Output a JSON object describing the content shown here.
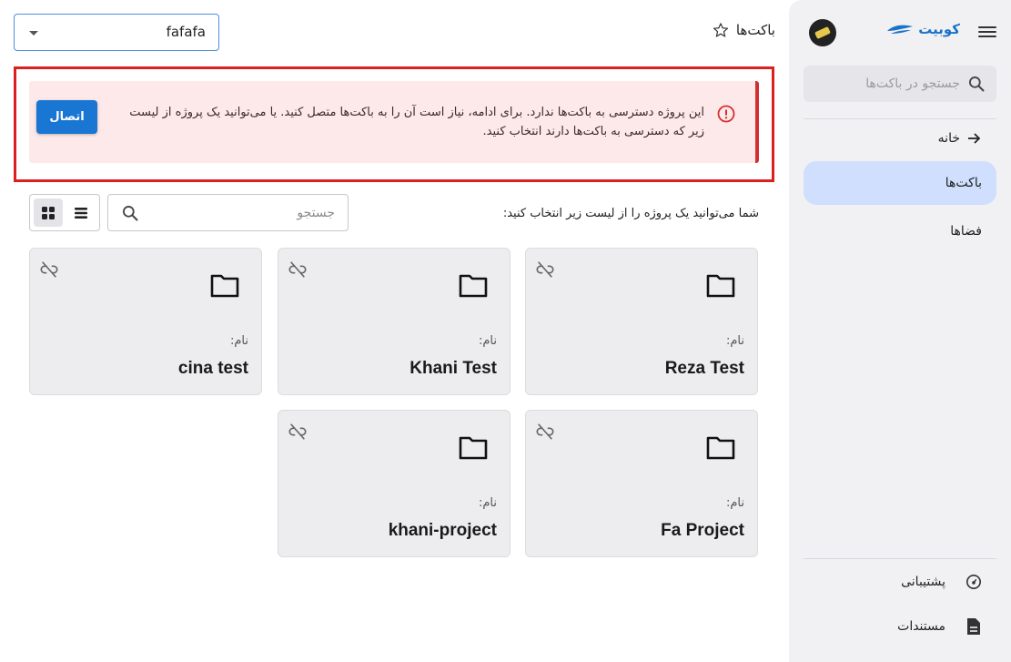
{
  "header": {
    "project_select_value": "fafafa",
    "page_title": "باکت‌ها"
  },
  "alert": {
    "message": "این پروژه دسترسی به باکت‌ها ندارد. برای ادامه، نیاز است آن را به باکت‌ها متصل کنید. یا می‌توانید یک پروژه از لیست زیر که دسترسی به باکت‌ها دارند انتخاب کنید.",
    "connect_label": "اتصال"
  },
  "main": {
    "instruction": "شما می‌توانید یک پروژه را از لیست زیر انتخاب کنید:",
    "search_placeholder": "جستجو",
    "name_label": "نام:",
    "cards": [
      {
        "name": "Reza Test"
      },
      {
        "name": "Khani Test"
      },
      {
        "name": "cina test"
      },
      {
        "name": "Fa Project"
      },
      {
        "name": "khani-project"
      }
    ]
  },
  "sidebar": {
    "brand": "کوبیت",
    "search_placeholder": "جستجو در باکت‌ها",
    "items": [
      {
        "label": "خانه"
      },
      {
        "label": "باکت‌ها"
      },
      {
        "label": "فضاها"
      }
    ],
    "footer": [
      {
        "label": "پشتیبانی"
      },
      {
        "label": "مستندات"
      }
    ]
  },
  "colors": {
    "accent": "#1976d2",
    "alert_bg": "#fde9e9",
    "alert_border": "#d32f2f",
    "highlight": "#dc1f1f",
    "active_nav": "#cfdffd"
  }
}
